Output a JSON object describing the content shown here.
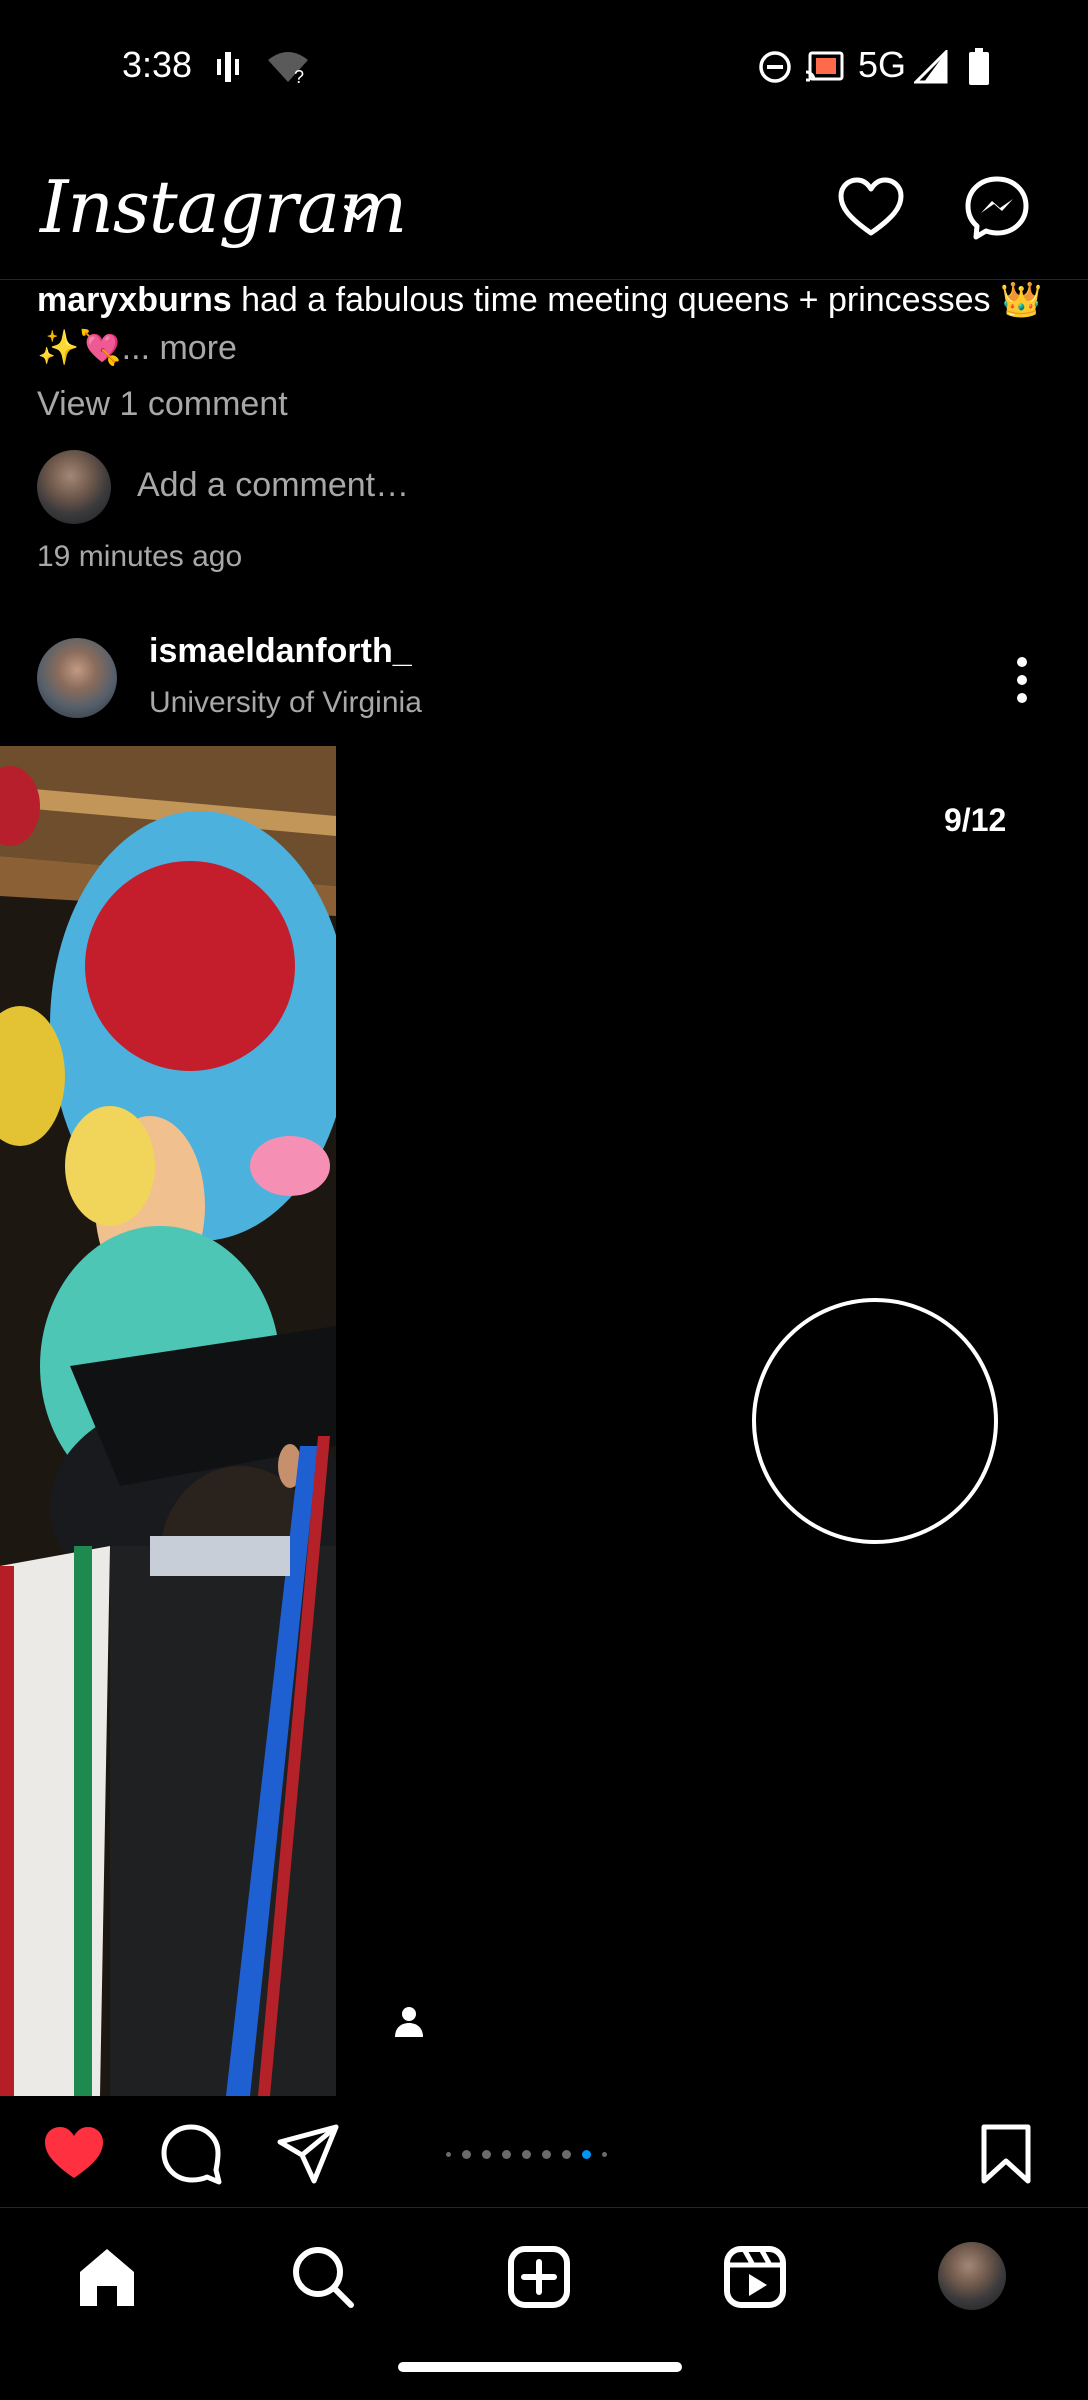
{
  "status_bar": {
    "time": "3:38",
    "network": "5G",
    "icons": [
      "vibrate-icon",
      "wifi-unknown-icon",
      "dnd-icon",
      "cast-icon",
      "signal-icon",
      "battery-icon"
    ]
  },
  "header": {
    "logo": "Instagram",
    "icons": [
      "chevron-down-icon",
      "heart-icon",
      "messenger-icon"
    ]
  },
  "previous_post": {
    "caption_user": "maryxburns",
    "caption_text": " had a fabulous time meeting queens + princesses 👑✨💘",
    "caption_more": "... more",
    "view_comments": "View 1 comment",
    "comment_placeholder": "Add a comment…",
    "timestamp": "19 minutes ago"
  },
  "post": {
    "username": "ismaeldanforth_",
    "location": "University of Virginia",
    "counter": "9/12",
    "liked": true,
    "carousel": {
      "total_dots": 9,
      "active_index": 7
    }
  },
  "actions": [
    "heart-filled-icon",
    "comment-icon",
    "share-icon",
    "bookmark-icon"
  ],
  "bottom_nav": [
    "home-icon",
    "search-icon",
    "create-icon",
    "reels-icon",
    "profile-avatar"
  ],
  "colors": {
    "like_red": "#ff3040",
    "active_dot": "#0095f6",
    "secondary_text": "#a8a8a8"
  }
}
